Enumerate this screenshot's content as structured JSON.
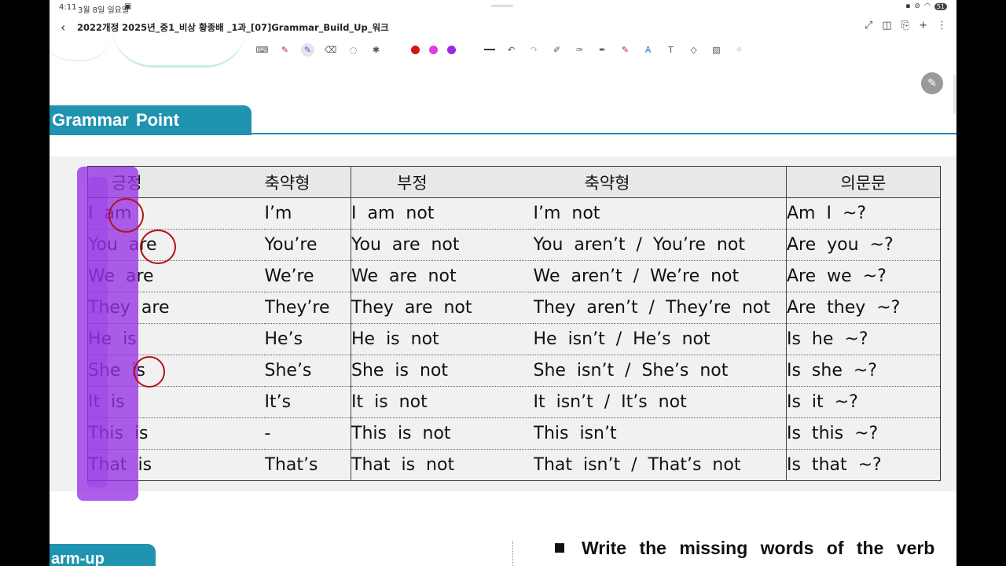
{
  "status_bar": {
    "time": "4:11",
    "date": "3월 8일 일요일",
    "battery": "51"
  },
  "title_bar": {
    "title": "2022개정 2025년_중1_비상 황종배 _1과_[07]Grammar_Build_Up_워크"
  },
  "toolbar": {
    "colors": [
      "#d2121a",
      "#e03ce0",
      "#9a2be0"
    ]
  },
  "section": {
    "title": "Grammar  Point"
  },
  "table": {
    "headers": [
      "긍정",
      "축약형",
      "부정",
      "축약형",
      "의문문"
    ],
    "rows": [
      [
        "I  am",
        "I’m",
        "I  am  not",
        "I’m  not",
        "Am  I  ~?"
      ],
      [
        "You  are",
        "You’re",
        "You  are  not",
        "You  aren’t  /  You’re  not",
        "Are  you  ~?"
      ],
      [
        "We  are",
        "We’re",
        "We  are  not",
        "We  aren’t  /  We’re  not",
        "Are  we  ~?"
      ],
      [
        "They  are",
        "They’re",
        "They  are  not",
        "They  aren’t  /  They’re  not",
        "Are  they  ~?"
      ],
      [
        "He  is",
        "He’s",
        "He  is  not",
        "He  isn’t  /  He’s  not",
        "Is  he  ~?"
      ],
      [
        "She  is",
        "She’s",
        "She  is  not",
        "She  isn’t  /  She’s  not",
        "Is  she  ~?"
      ],
      [
        "It  is",
        "It’s",
        "It  is  not",
        "It  isn’t  /  It’s  not",
        "Is  it  ~?"
      ],
      [
        "This  is",
        "-",
        "This  is  not",
        "This  isn’t",
        "Is  this  ~?"
      ],
      [
        "That  is",
        "That’s",
        "That  is  not",
        "That  isn’t  /  That’s  not",
        "Is  that  ~?"
      ]
    ]
  },
  "warmup": {
    "label": "arm-up"
  },
  "instruction": {
    "text": "Write  the  missing  words  of  the  verb"
  }
}
